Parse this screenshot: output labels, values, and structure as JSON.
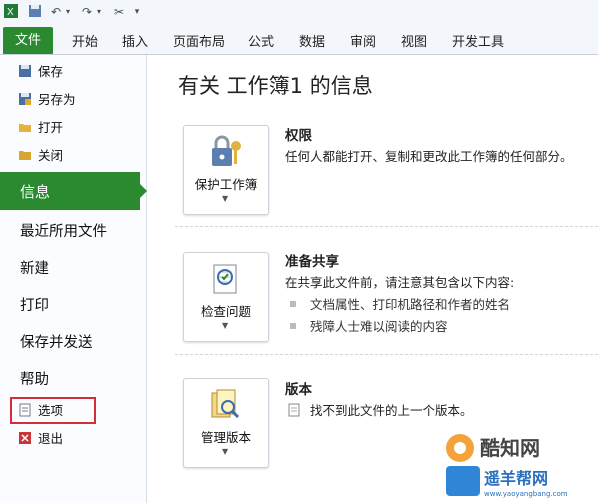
{
  "ribbon": {
    "file_tab": "文件",
    "tabs": [
      "开始",
      "插入",
      "页面布局",
      "公式",
      "数据",
      "审阅",
      "视图",
      "开发工具"
    ]
  },
  "sidebar": {
    "small_items": [
      "保存",
      "另存为",
      "打开",
      "关闭"
    ],
    "active": "信息",
    "items": [
      "最近所用文件",
      "新建",
      "打印",
      "保存并发送",
      "帮助"
    ],
    "options": "选项",
    "exit": "退出"
  },
  "main": {
    "title": "有关 工作簿1 的信息",
    "sections": [
      {
        "button": "保护工作簿",
        "heading": "权限",
        "desc": "任何人都能打开、复制和更改此工作簿的任何部分。"
      },
      {
        "button": "检查问题",
        "heading": "准备共享",
        "desc": "在共享此文件前，请注意其包含以下内容:",
        "bullets": [
          "文档属性、打印机路径和作者的姓名",
          "残障人士难以阅读的内容"
        ]
      },
      {
        "button": "管理版本",
        "heading": "版本",
        "desc": "找不到此文件的上一个版本。"
      }
    ]
  },
  "watermark": {
    "brand": "酷知网",
    "sub": "www.yaoyangbang.com",
    "sub2": "遥羊帮网"
  },
  "colors": {
    "accent": "#2b8a2f",
    "highlight_box": "#d1303a"
  }
}
